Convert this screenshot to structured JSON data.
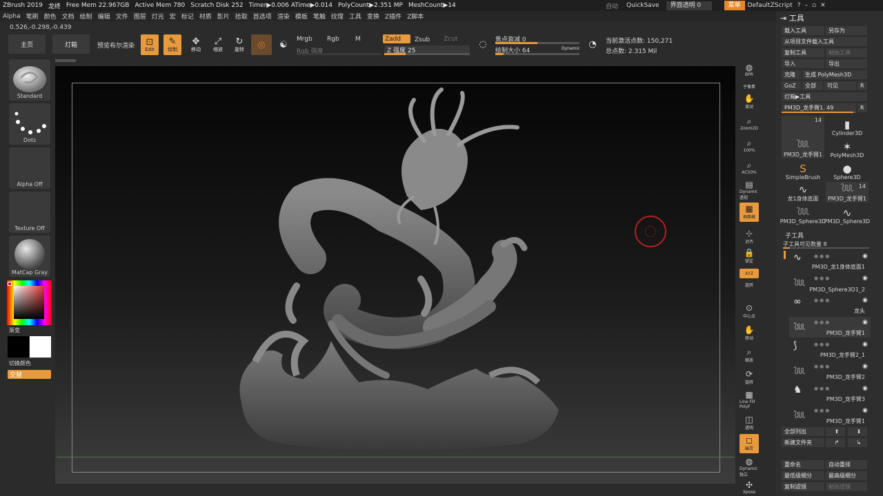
{
  "titlebar": {
    "app": "ZBrush 2019",
    "doc": "龙终",
    "free_mem": "Free Mem 22.967GB",
    "active_mem": "Active Mem 780",
    "scratch": "Scratch Disk 252",
    "timer": "Timer▶0.006 ATime▶0.014",
    "polycount": "PolyCount▶2.351 MP",
    "meshcount": "MeshCount▶14",
    "auto": "自动",
    "quicksave": "QuickSave",
    "transparency": "界面透明 0",
    "menu": "菜单",
    "zscript": "DefaultZScript"
  },
  "menus": [
    "Alpha",
    "笔刷",
    "颜色",
    "文档",
    "绘制",
    "编辑",
    "文件",
    "图层",
    "灯光",
    "宏",
    "标记",
    "材质",
    "影片",
    "拾取",
    "首选项",
    "渲染",
    "模板",
    "笔触",
    "纹理",
    "工具",
    "变换",
    "Z插件",
    "Z脚本"
  ],
  "coords": "0.526,-0.298,-0.439",
  "toolbar": {
    "home": "主页",
    "lightbox": "灯箱",
    "bpr": "预览布尔渲染",
    "edit": "Edit",
    "draw": "绘制",
    "move": "移动",
    "scale": "缩放",
    "rotate": "旋转",
    "mrgb": "Mrgb",
    "rgb": "Rgb",
    "m": "M",
    "zadd": "Zadd",
    "zsub": "Zsub",
    "zcut": "Zcut",
    "rgb_intensity": "Rgb 强度",
    "z_intensity": "Z 强度 25",
    "focal_shift": "焦点衰减 0",
    "draw_size": "绘制大小 64",
    "dynamic": "Dynamic",
    "active_points": "当前激活点数: 150,271",
    "total_points": "总点数: 2.315 Mil",
    "z_intensity_level": 0.25,
    "draw_size_level": 0.1,
    "focal_level": 0.5
  },
  "left_palette": {
    "brush": "Standard",
    "stroke": "Dots",
    "alpha": "Alpha Off",
    "texture": "Texture Off",
    "material": "MatCap Gray",
    "gradient": "渐变",
    "switch_color": "切换颜色",
    "alternate": "交替"
  },
  "right_shelf": [
    "BPR",
    "子像素",
    "滚动",
    "Zoom2D",
    "100%",
    "AC50%",
    "Dynamic 透视",
    "地面格",
    "对齐",
    "锁定",
    "XYZ",
    "旋转",
    "中心点",
    "移动",
    "缩放",
    "旋转",
    "Line Fill PolyF",
    "透明",
    "幽灵",
    "Dynamic 独立",
    "Xpose"
  ],
  "tool_panel": {
    "title": "工具",
    "load_tool": "载入工具",
    "save_as": "另存为",
    "load_from_project": "从项目文件载入工具",
    "copy_tool": "复制工具",
    "paste_tool": "粘贴工具",
    "import": "导入",
    "export": "导出",
    "clone": "克隆",
    "make_polymesh": "生成 PolyMesh3D",
    "goz": "GoZ",
    "all": "全部",
    "visible": "可见",
    "r": "R",
    "lightbox_tools": "灯箱▶工具",
    "current_tool": "PM3D_龙手臂1. 49",
    "tools": [
      {
        "name": "PM3D_龙手臂1",
        "count": "14",
        "icon": "dragon-arm-icon"
      },
      {
        "name": "Cylinder3D",
        "count": "",
        "icon": "cylinder-icon"
      },
      {
        "name": "PolyMesh3D",
        "count": "",
        "icon": "star-icon"
      },
      {
        "name": "SimpleBrush",
        "count": "",
        "icon": "s-brush-icon"
      },
      {
        "name": "Sphere3D",
        "count": "",
        "icon": "sphere-icon"
      },
      {
        "name": "龙1身体底面",
        "count": "",
        "icon": "dragon-body-icon"
      },
      {
        "name": "PM3D_龙手臂1",
        "count": "14",
        "icon": "dragon-arm-icon"
      },
      {
        "name": "PM3D_Sphere3D",
        "count": "",
        "icon": "dragon-arm-icon"
      },
      {
        "name": "PM3D_Sphere3D",
        "count": "",
        "icon": "dragon-body-icon"
      }
    ],
    "subtool_title": "子工具",
    "subtool_visible": "子工具可见数量 8",
    "subtools": [
      "PM3D_龙1身体底面1",
      "PM3D_Sphere3D1_2",
      "龙头",
      "PM3D_龙手臂1",
      "PM3D_龙手臂2_1",
      "PM3D_龙手臂2",
      "PM3D_龙手臂3",
      "PM3D_龙手臂1"
    ],
    "list_all": "全部列出",
    "new_folder": "新建文件夹",
    "rename": "重命名",
    "auto_reorder": "自动重排",
    "lowest_subdiv": "最低级细分",
    "highest_subdiv": "最高级细分",
    "copy_subtool": "复制滤镜",
    "paste_subtool": "粘贴滤镜"
  },
  "colors": {
    "accent": "#e89a3c",
    "panel": "#2e2e2e",
    "button": "#3a3a3a"
  }
}
